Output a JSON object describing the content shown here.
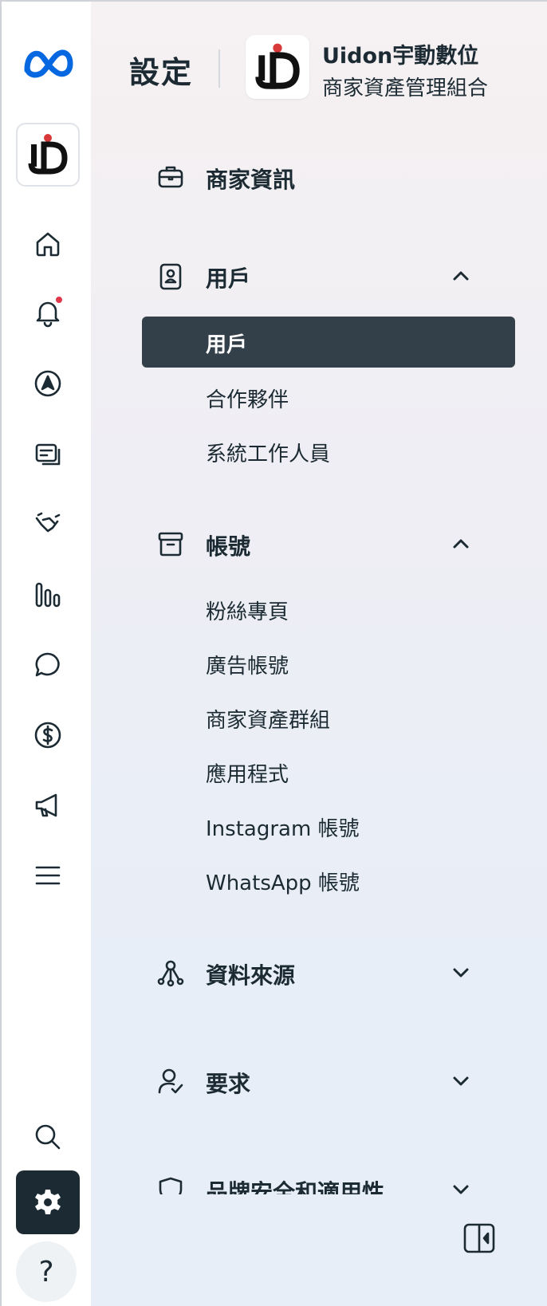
{
  "header": {
    "title": "設定",
    "business_name": "Uidon宇動數位",
    "business_subtitle": "商家資產管理組合"
  },
  "rail": {
    "icons": [
      "meta-logo",
      "business-avatar",
      "home-icon",
      "bell-icon",
      "compass-icon",
      "card-icon",
      "handshake-icon",
      "bar-chart-icon",
      "chat-icon",
      "dollar-icon",
      "megaphone-icon",
      "menu-icon",
      "search-icon",
      "gear-icon",
      "help-icon"
    ],
    "help_label": "?"
  },
  "sections": {
    "business_info": {
      "label": "商家資訊"
    },
    "users": {
      "label": "用戶",
      "expanded": true,
      "items": [
        "用戶",
        "合作夥伴",
        "系統工作人員"
      ],
      "active": "用戶"
    },
    "accounts": {
      "label": "帳號",
      "expanded": true,
      "items": [
        "粉絲專頁",
        "廣告帳號",
        "商家資產群組",
        "應用程式",
        "Instagram 帳號",
        "WhatsApp 帳號"
      ]
    },
    "data_sources": {
      "label": "資料來源",
      "expanded": false
    },
    "requests": {
      "label": "要求",
      "expanded": false
    },
    "brand_safety": {
      "label": "品牌安全和適用性",
      "expanded": false
    }
  },
  "colors": {
    "accent_dark": "#1c2b33",
    "active_item_bg": "#344049",
    "meta_blue": "#0668e1",
    "notification": "#e0384a"
  }
}
